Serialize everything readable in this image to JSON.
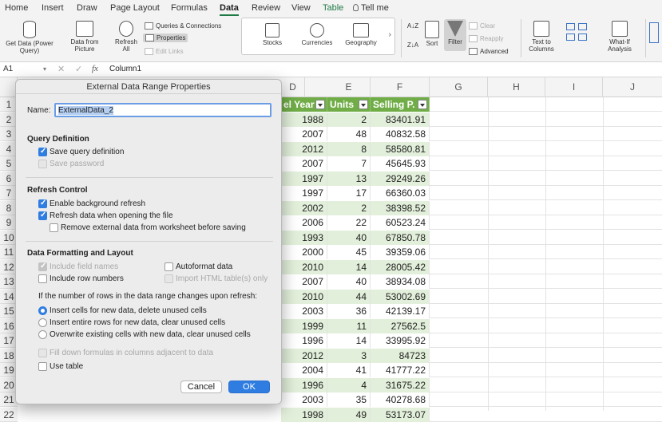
{
  "ribbon_tabs": [
    "Home",
    "Insert",
    "Draw",
    "Page Layout",
    "Formulas",
    "Data",
    "Review",
    "View",
    "Table",
    "Tell me"
  ],
  "ribbon": {
    "get_data": "Get Data (Power Query)",
    "data_from_picture": "Data from Picture",
    "refresh_all": "Refresh All",
    "queries_connections": "Queries & Connections",
    "properties": "Properties",
    "edit_links": "Edit Links",
    "stocks": "Stocks",
    "currencies": "Currencies",
    "geography": "Geography",
    "sort": "Sort",
    "filter": "Filter",
    "clear": "Clear",
    "reapply": "Reapply",
    "advanced": "Advanced",
    "text_to_columns": "Text to Columns",
    "what_if": "What-If Analysis"
  },
  "formula_bar": {
    "name_box": "A1",
    "fx": "fx",
    "content": "Column1"
  },
  "columns": [
    "D",
    "E",
    "F",
    "G",
    "H",
    "I",
    "J"
  ],
  "rows": [
    "1",
    "2",
    "3",
    "4",
    "5",
    "6",
    "7",
    "8",
    "9",
    "10",
    "11",
    "12",
    "13",
    "14",
    "15",
    "16",
    "17",
    "18",
    "19",
    "20",
    "21",
    "22"
  ],
  "table": {
    "headers": [
      "el Year",
      "Units",
      "Selling P."
    ],
    "data": [
      [
        "1988",
        "2",
        "83401.91"
      ],
      [
        "2007",
        "48",
        "40832.58"
      ],
      [
        "2012",
        "8",
        "58580.81"
      ],
      [
        "2007",
        "7",
        "45645.93"
      ],
      [
        "1997",
        "13",
        "29249.26"
      ],
      [
        "1997",
        "17",
        "66360.03"
      ],
      [
        "2002",
        "2",
        "38398.52"
      ],
      [
        "2006",
        "22",
        "60523.24"
      ],
      [
        "1993",
        "40",
        "67850.78"
      ],
      [
        "2000",
        "45",
        "39359.06"
      ],
      [
        "2010",
        "14",
        "28005.42"
      ],
      [
        "2007",
        "40",
        "38934.08"
      ],
      [
        "2010",
        "44",
        "53002.69"
      ],
      [
        "2003",
        "36",
        "42139.17"
      ],
      [
        "1999",
        "11",
        "27562.5"
      ],
      [
        "1996",
        "14",
        "33995.92"
      ],
      [
        "2012",
        "3",
        "84723"
      ],
      [
        "2004",
        "41",
        "41777.22"
      ],
      [
        "1996",
        "4",
        "31675.22"
      ],
      [
        "2003",
        "35",
        "40278.68"
      ],
      [
        "1998",
        "49",
        "53173.07"
      ]
    ]
  },
  "dialog": {
    "title": "External Data Range Properties",
    "name_label": "Name:",
    "name_value": "ExternalData_2",
    "query_section": "Query Definition",
    "save_query": "Save query definition",
    "save_password": "Save password",
    "refresh_section": "Refresh Control",
    "enable_background": "Enable background refresh",
    "refresh_on_open": "Refresh data when opening the file",
    "remove_external": "Remove external data from worksheet before saving",
    "format_section": "Data Formatting and Layout",
    "include_field_names": "Include field names",
    "autoformat": "Autoformat data",
    "include_row_numbers": "Include row numbers",
    "import_html": "Import HTML table(s) only",
    "rows_change_label": "If the number of rows in the data range changes upon refresh:",
    "option_insert_cells": "Insert cells for new data, delete unused cells",
    "option_insert_rows": "Insert entire rows for new data, clear unused cells",
    "option_overwrite": "Overwrite existing cells with new data, clear unused cells",
    "fill_down": "Fill down formulas in columns adjacent to data",
    "use_table": "Use table",
    "cancel": "Cancel",
    "ok": "OK"
  },
  "colors": {
    "table_header": "#70ad47",
    "band": "#e2efda",
    "accent": "#2f7de1",
    "tab_active": "#1f7a45"
  }
}
